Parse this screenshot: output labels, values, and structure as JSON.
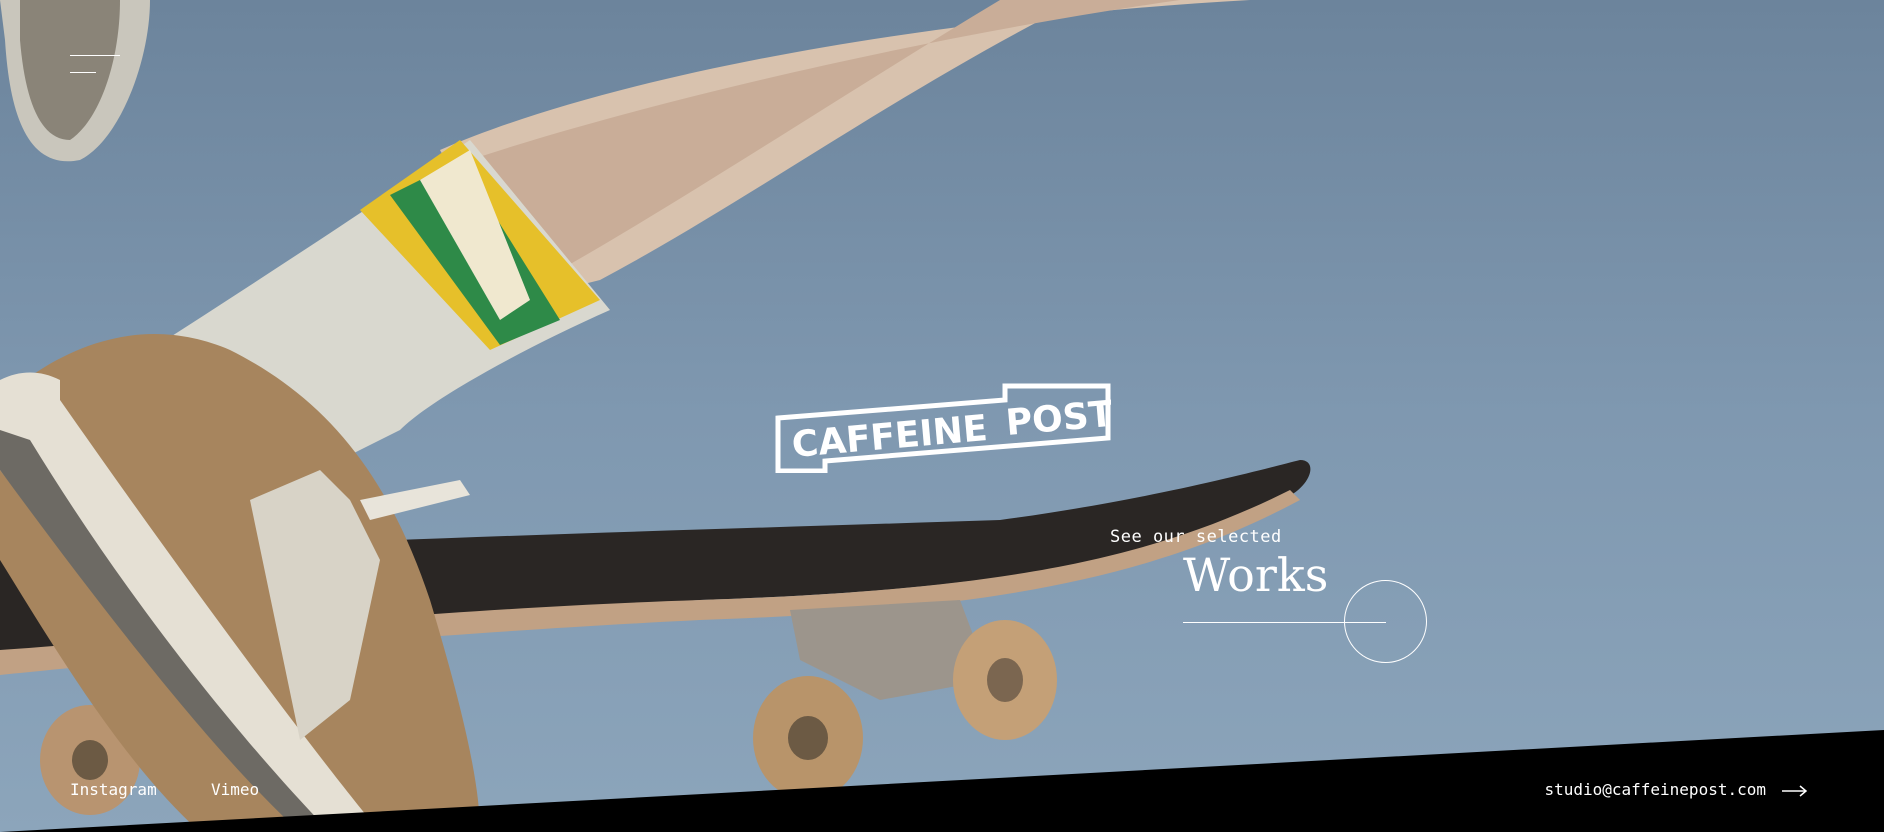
{
  "brand": {
    "logo_left": "CAFFEINE",
    "logo_right": "POST"
  },
  "nav": {
    "menu_icon": "hamburger-menu-icon"
  },
  "cta": {
    "kicker": "See our selected",
    "title": "Works"
  },
  "footer": {
    "instagram": "Instagram",
    "vimeo": "Vimeo",
    "email": "studio@caffeinepost.com",
    "arrow_icon": "arrow-right-icon"
  },
  "colors": {
    "sky": "#7f97ad",
    "footer_band": "#000000",
    "text": "#ffffff"
  }
}
